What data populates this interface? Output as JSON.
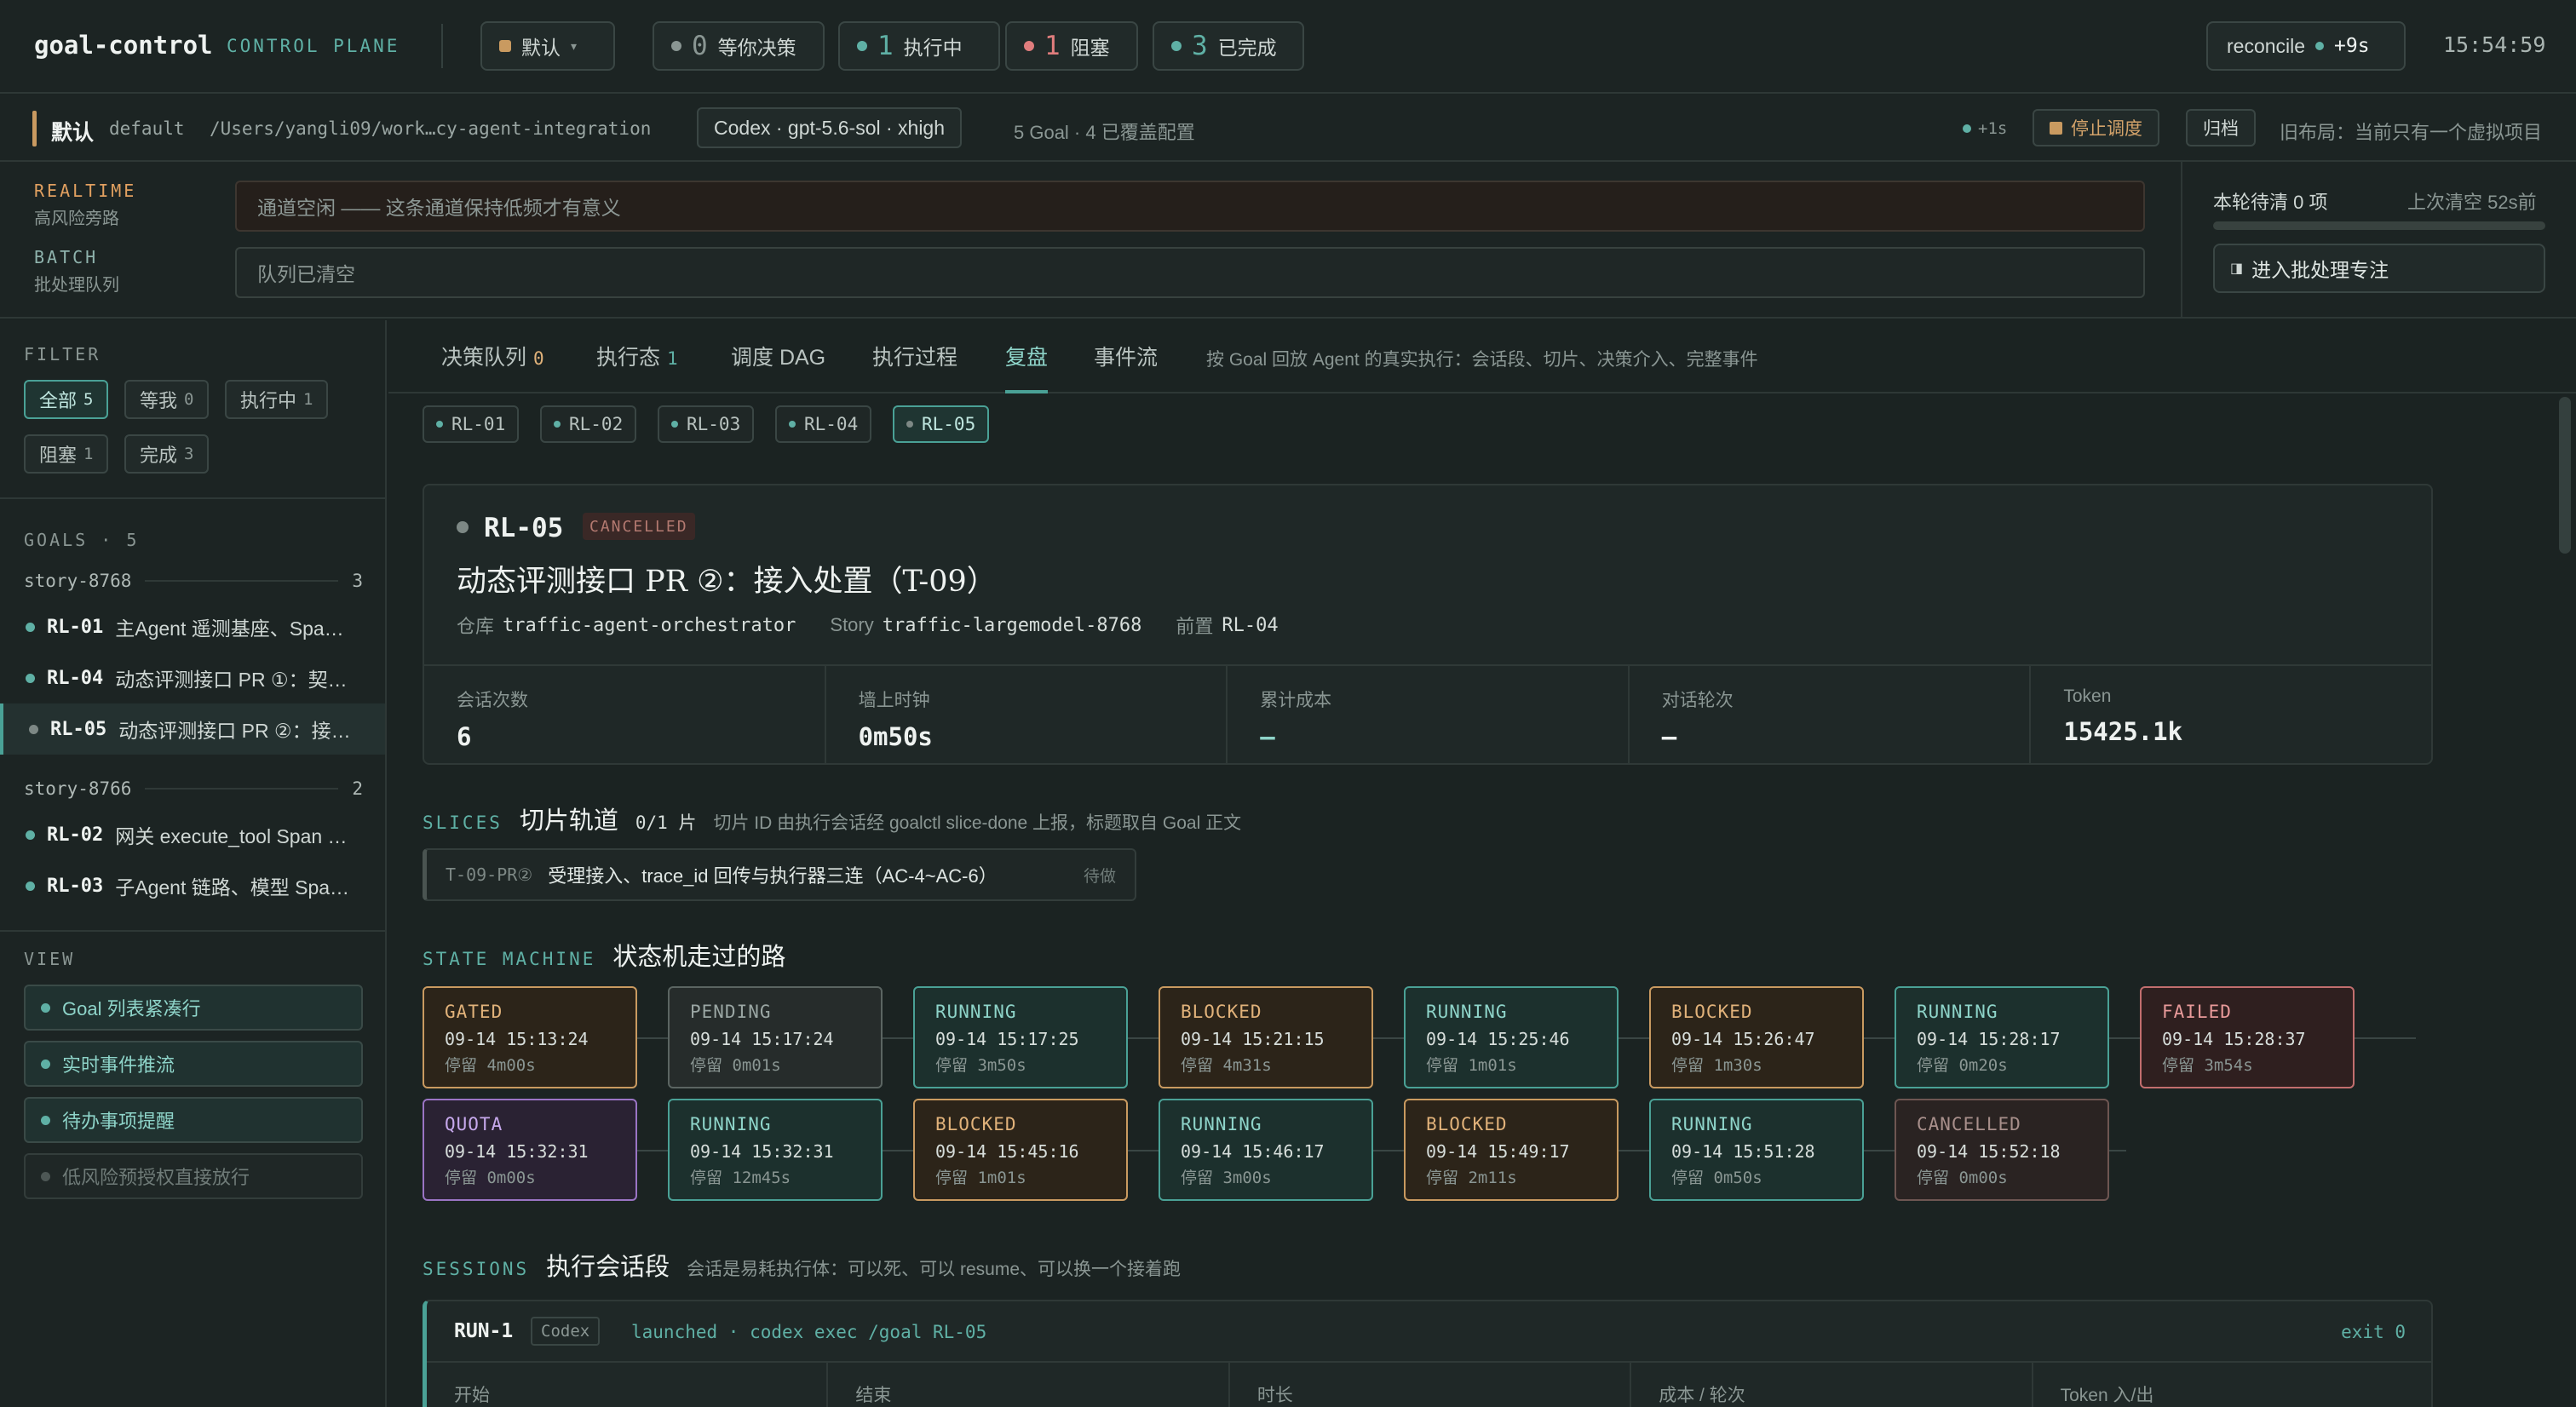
{
  "topbar": {
    "brand": "goal-control",
    "brand_sub": "CONTROL PLANE",
    "workspace": "默认",
    "status": [
      {
        "num": "0",
        "label": "等你决策",
        "color": "#8a9693"
      },
      {
        "num": "1",
        "label": "执行中",
        "color": "#5fb0a5"
      },
      {
        "num": "1",
        "label": "阻塞",
        "color": "#e07d7d"
      },
      {
        "num": "3",
        "label": "已完成",
        "color": "#5fb0a5"
      }
    ],
    "reconcile_label": "reconcile",
    "reconcile_delta": "+9s",
    "clock": "15:54:59"
  },
  "wsbar": {
    "name": "默认",
    "slug": "default",
    "path": "/Users/yangli09/work…cy-agent-integration",
    "model": "Codex · gpt-5.6-sol · xhigh",
    "counts": "5 Goal · 4 已覆盖配置",
    "plus": "+1s",
    "stop_label": "停止调度",
    "archive_label": "归档",
    "old_layout": "旧布局：当前只有一个虚拟项目"
  },
  "lanes": {
    "realtime_title": "REALTIME",
    "realtime_sub": "高风险旁路",
    "realtime_text": "通道空闲 —— 这条通道保持低频才有意义",
    "batch_title": "BATCH",
    "batch_sub": "批处理队列",
    "batch_text": "队列已清空",
    "pending_info": "本轮待清 0 项",
    "last_clear": "上次清空  52s前",
    "focus_btn": "进入批处理专注"
  },
  "sidebar": {
    "filter_title": "FILTER",
    "filters": [
      {
        "label": "全部",
        "count": "5",
        "active": true
      },
      {
        "label": "等我",
        "count": "0",
        "active": false
      },
      {
        "label": "执行中",
        "count": "1",
        "active": false
      },
      {
        "label": "阻塞",
        "count": "1",
        "active": false
      },
      {
        "label": "完成",
        "count": "3",
        "active": false
      }
    ],
    "goals_title": "GOALS · 5",
    "groups": [
      {
        "name": "story-8768",
        "count": "3"
      },
      {
        "name": "story-8766",
        "count": "2"
      }
    ],
    "goals": [
      {
        "id": "RL-01",
        "text": "主Agent 遥测基座、Spa…"
      },
      {
        "id": "RL-04",
        "text": "动态评测接口 PR ①：契…"
      },
      {
        "id": "RL-05",
        "text": "动态评测接口 PR ②：接…"
      },
      {
        "id": "RL-02",
        "text": "网关 execute_tool Span …"
      },
      {
        "id": "RL-03",
        "text": "子Agent 链路、模型 Spa…"
      }
    ],
    "view_title": "VIEW",
    "views": [
      {
        "label": "Goal 列表紧凑行",
        "on": true
      },
      {
        "label": "实时事件推流",
        "on": true
      },
      {
        "label": "待办事项提醒",
        "on": true
      },
      {
        "label": "低风险预授权直接放行",
        "on": false
      }
    ]
  },
  "tabs": {
    "items": [
      {
        "label": "决策队列",
        "count": "0",
        "count_color": "#e1b27a"
      },
      {
        "label": "执行态",
        "count": "1",
        "count_color": "#5fb0a5"
      },
      {
        "label": "调度 DAG",
        "count": ""
      },
      {
        "label": "执行过程",
        "count": ""
      },
      {
        "label": "复盘",
        "count": ""
      },
      {
        "label": "事件流",
        "count": ""
      }
    ],
    "desc": "按 Goal 回放 Agent 的真实执行：会话段、切片、决策介入、完整事件"
  },
  "rl_chips": [
    "RL-01",
    "RL-02",
    "RL-03",
    "RL-04",
    "RL-05"
  ],
  "card": {
    "id": "RL-05",
    "state": "CANCELLED",
    "title": "动态评测接口 PR ②：接入处置（T-09）",
    "repo_label": "仓库",
    "repo": "traffic-agent-orchestrator",
    "story_label": "Story",
    "story": "traffic-largemodel-8768",
    "pre_label": "前置",
    "pre": "RL-04",
    "stats": [
      {
        "k": "会话次数",
        "v": "6"
      },
      {
        "k": "墙上时钟",
        "v": "0m50s"
      },
      {
        "k": "累计成本",
        "v": "—"
      },
      {
        "k": "对话轮次",
        "v": "—"
      },
      {
        "k": "Token",
        "v": "15425.1k"
      }
    ]
  },
  "slices": {
    "en": "SLICES",
    "zh": "切片轨道",
    "count": "0/1 片",
    "desc": "切片 ID 由执行会话经 goalctl slice-done 上报，标题取自 Goal 正文",
    "item_id": "T-09-PR②",
    "item_text": "受理接入、trace_id 回传与执行器三连（AC-4~AC-6）",
    "item_status": "待做"
  },
  "state_machine": {
    "en": "STATE MACHINE",
    "zh": "状态机走过的路",
    "nodes": [
      {
        "state": "GATED",
        "time": "09-14 15:13:24",
        "stay": "停留 4m00s",
        "kind": "gated"
      },
      {
        "state": "PENDING",
        "time": "09-14 15:17:24",
        "stay": "停留 0m01s",
        "kind": "pending"
      },
      {
        "state": "RUNNING",
        "time": "09-14 15:17:25",
        "stay": "停留 3m50s",
        "kind": "running"
      },
      {
        "state": "BLOCKED",
        "time": "09-14 15:21:15",
        "stay": "停留 4m31s",
        "kind": "blocked"
      },
      {
        "state": "RUNNING",
        "time": "09-14 15:25:46",
        "stay": "停留 1m01s",
        "kind": "running"
      },
      {
        "state": "BLOCKED",
        "time": "09-14 15:26:47",
        "stay": "停留 1m30s",
        "kind": "blocked"
      },
      {
        "state": "RUNNING",
        "time": "09-14 15:28:17",
        "stay": "停留 0m20s",
        "kind": "running"
      },
      {
        "state": "FAILED",
        "time": "09-14 15:28:37",
        "stay": "停留 3m54s",
        "kind": "failed"
      },
      {
        "state": "QUOTA",
        "time": "09-14 15:32:31",
        "stay": "停留 0m00s",
        "kind": "quota"
      },
      {
        "state": "RUNNING",
        "time": "09-14 15:32:31",
        "stay": "停留 12m45s",
        "kind": "running"
      },
      {
        "state": "BLOCKED",
        "time": "09-14 15:45:16",
        "stay": "停留 1m01s",
        "kind": "blocked"
      },
      {
        "state": "RUNNING",
        "time": "09-14 15:46:17",
        "stay": "停留 3m00s",
        "kind": "running"
      },
      {
        "state": "BLOCKED",
        "time": "09-14 15:49:17",
        "stay": "停留 2m11s",
        "kind": "blocked"
      },
      {
        "state": "RUNNING",
        "time": "09-14 15:51:28",
        "stay": "停留 0m50s",
        "kind": "running"
      },
      {
        "state": "CANCELLED",
        "time": "09-14 15:52:18",
        "stay": "停留 0m00s",
        "kind": "cancelled"
      }
    ]
  },
  "sessions": {
    "en": "SESSIONS",
    "zh": "执行会话段",
    "desc": "会话是易耗执行体：可以死、可以 resume、可以换一个接着跑",
    "run_id": "RUN-1",
    "run_tag": "Codex",
    "run_cmd": "launched · codex exec /goal RL-05",
    "run_exit": "exit 0",
    "cols": [
      "开始",
      "结束",
      "时长",
      "成本 / 轮次",
      "Token 入/出"
    ]
  }
}
